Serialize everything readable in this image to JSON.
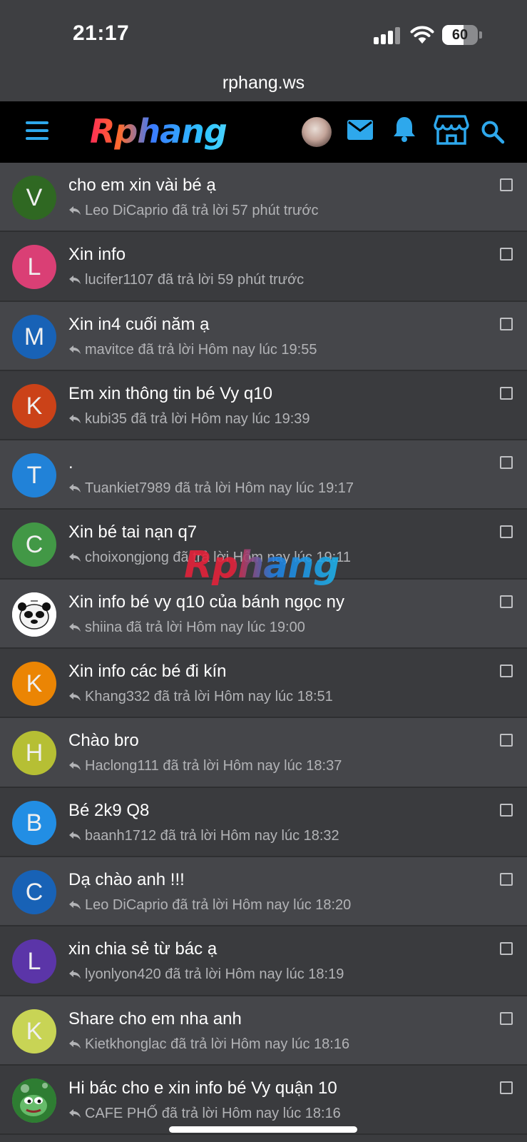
{
  "status_bar": {
    "time": "21:17",
    "battery": "60",
    "battery_level": 0.6
  },
  "browser": {
    "url": "rphang.ws"
  },
  "header": {
    "logo_text": "Rphang",
    "accent_color": "#2ea8ec"
  },
  "watermark": "Rphang",
  "threads": [
    {
      "title": "cho em xin vài bé ạ",
      "meta": "Leo DiCaprio đã trả lời 57 phút trước",
      "avatar_letter": "V",
      "avatar_color": "#2e6b1f"
    },
    {
      "title": "Xin info",
      "meta": "lucifer1107 đã trả lời 59 phút trước",
      "avatar_letter": "L",
      "avatar_color": "#e8407a"
    },
    {
      "title": "Xin in4 cuối năm ạ",
      "meta": "mavitce đã trả lời Hôm nay lúc 19:55",
      "avatar_letter": "M",
      "avatar_color": "#1565c0"
    },
    {
      "title": "Em xin thông tin bé Vy q10",
      "meta": "kubi35 đã trả lời Hôm nay lúc 19:39",
      "avatar_letter": "K",
      "avatar_color": "#d84315"
    },
    {
      "title": ".",
      "meta": "Tuankiet7989 đã trả lời Hôm nay lúc 19:17",
      "avatar_letter": "T",
      "avatar_color": "#1e88e5"
    },
    {
      "title": "Xin bé tai nạn q7",
      "meta": "choixongjong đã trả lời Hôm nay lúc 19:11",
      "avatar_letter": "C",
      "avatar_color": "#43a047"
    },
    {
      "title": "Xin info bé vy q10 của bánh ngọc ny",
      "meta": "shiina đã trả lời Hôm nay lúc 19:00",
      "avatar_letter": "",
      "avatar_color": "#ffffff",
      "avatar_image": "panda-meme"
    },
    {
      "title": "Xin info các bé đi kín",
      "meta": "Khang332 đã trả lời Hôm nay lúc 18:51",
      "avatar_letter": "K",
      "avatar_color": "#fb8c00"
    },
    {
      "title": "Chào bro",
      "meta": "Haclong111 đã trả lời Hôm nay lúc 18:37",
      "avatar_letter": "H",
      "avatar_color": "#c0ca33"
    },
    {
      "title": "Bé 2k9 Q8",
      "meta": "baanh1712 đã trả lời Hôm nay lúc 18:32",
      "avatar_letter": "B",
      "avatar_color": "#2196f3"
    },
    {
      "title": "Dạ chào anh !!!",
      "meta": "Leo DiCaprio đã trả lời Hôm nay lúc 18:20",
      "avatar_letter": "C",
      "avatar_color": "#1565c0"
    },
    {
      "title": "xin chia sẻ từ bác ạ",
      "meta": "lyonlyon420 đã trả lời Hôm nay lúc 18:19",
      "avatar_letter": "L",
      "avatar_color": "#5e35b1"
    },
    {
      "title": "Share cho em nha anh",
      "meta": "Kietkhonglac đã trả lời Hôm nay lúc 18:16",
      "avatar_letter": "K",
      "avatar_color": "#d4e157"
    },
    {
      "title": "Hi bác cho e xin info bé Vy quận 10",
      "meta": "CAFE PHỐ đã trả lời Hôm nay lúc 18:16",
      "avatar_letter": "",
      "avatar_color": "#4caf50",
      "avatar_image": "pepe-frog"
    }
  ]
}
